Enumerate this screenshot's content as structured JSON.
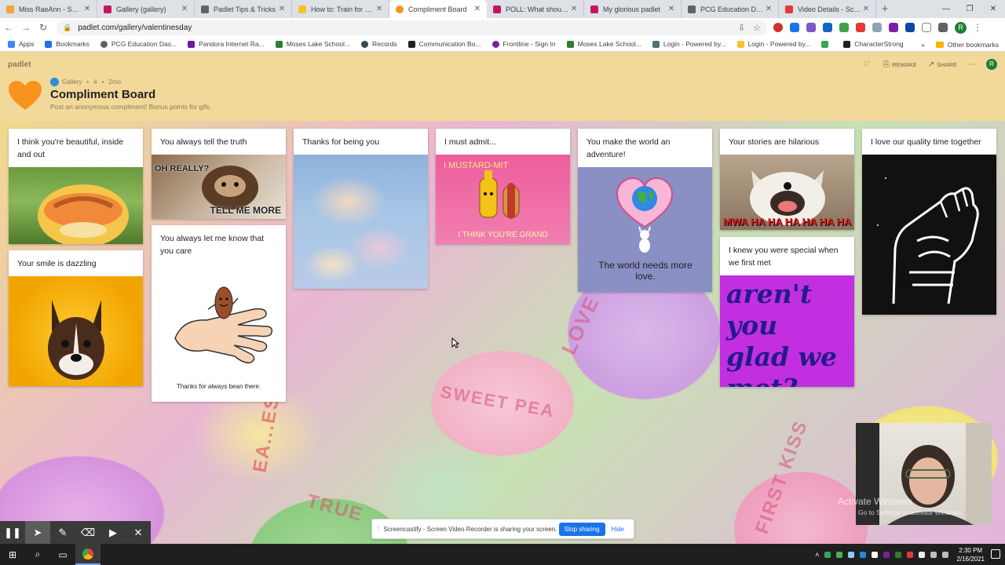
{
  "browser": {
    "tabs": [
      {
        "title": "Miss RaeAnn - Speech",
        "color": "#f2a33a"
      },
      {
        "title": "Gallery (gallery)",
        "color": "#c2185b"
      },
      {
        "title": "Padlet Tips & Tricks",
        "color": "#5f6368"
      },
      {
        "title": "How to: Train for your",
        "color": "#fbc02d"
      },
      {
        "title": "Compliment Board",
        "color": "#f7931e",
        "active": true
      },
      {
        "title": "POLL: What should the",
        "color": "#c2185b"
      },
      {
        "title": "My glorious padlet",
        "color": "#c2185b"
      },
      {
        "title": "PCG Education Dashbo",
        "color": "#5f6368"
      },
      {
        "title": "Video Details - Screen",
        "color": "#e53935"
      }
    ],
    "url": "padlet.com/gallery/valentinesday",
    "profile_initial": "R",
    "bookmarks": [
      {
        "label": "Apps",
        "color": "#4285f4"
      },
      {
        "label": "Bookmarks",
        "color": "#1a73e8"
      },
      {
        "label": "PCG Education Das...",
        "color": "#5f6368"
      },
      {
        "label": "Pandora Internet Ra...",
        "color": "#6a1b9a"
      },
      {
        "label": "Moses Lake School...",
        "color": "#2e7d32"
      },
      {
        "label": "Records",
        "color": "#37474f"
      },
      {
        "label": "Communication Bo...",
        "color": "#212121"
      },
      {
        "label": "Frontline - Sign In",
        "color": "#7b1fa2"
      },
      {
        "label": "Moses Lake School...",
        "color": "#2e7d32"
      },
      {
        "label": "Login - Powered by...",
        "color": "#546e7a"
      },
      {
        "label": "Login - Powered by...",
        "color": "#fbc02d"
      },
      {
        "label": "",
        "color": "#34a853"
      },
      {
        "label": "CharacterStrong",
        "color": "#212121"
      }
    ],
    "other_bookmarks": "Other bookmarks"
  },
  "padlet": {
    "brand": "padlet",
    "meta": {
      "author": "Gallery",
      "likes": "4",
      "age": "2mo"
    },
    "title": "Compliment Board",
    "description": "Post an anonymous compliment! Bonus points for gifs.",
    "actions": {
      "remake": "REMAKE",
      "share": "SHARE"
    },
    "user_initial": "R"
  },
  "cards": [
    {
      "caption": "I think you're beautiful, inside and out"
    },
    {
      "caption": "Your smile is dazzling"
    },
    {
      "caption": "You always tell the truth",
      "media_text_top": "OH REALLY?",
      "media_text_bottom": "TELL ME MORE"
    },
    {
      "caption": "You always let me know that you care",
      "media_text": "Thanks for always bean there."
    },
    {
      "caption": "Thanks for being you"
    },
    {
      "caption": "I must admit...",
      "media_text_top": "I MUSTARD-MIT",
      "media_text_bottom": "I THINK YOU'RE GRAND"
    },
    {
      "caption": "You make the world an adventure!",
      "media_text": "The world needs more love."
    },
    {
      "caption": "Your stories are hilarious",
      "media_text": "MWA HA HA HA HA HA HA"
    },
    {
      "caption": "I knew you were special when we first met",
      "media_text": "aren't you glad we met?"
    },
    {
      "caption": "I love our quality time together"
    }
  ],
  "background_candy": [
    "SWEET PEA",
    "LOVE",
    "TRUE",
    "FIRST KISS",
    "EA...ES"
  ],
  "screencastify": {
    "message": "Screencastify - Screen Video Recorder is sharing your screen.",
    "stop": "Stop sharing",
    "hide": "Hide"
  },
  "windows": {
    "activate": "Activate Windows",
    "activate_sub": "Go to Settings to activate Windows.",
    "time": "2:30 PM",
    "date": "2/16/2021"
  }
}
